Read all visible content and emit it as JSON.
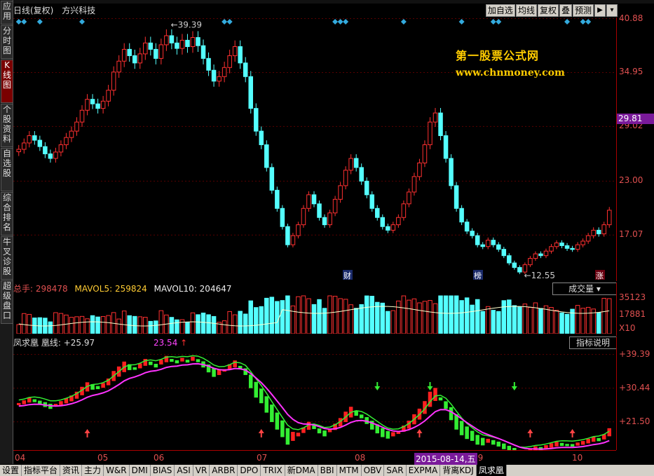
{
  "nav": [
    "应用",
    "分时图",
    "K线图",
    "个股资料",
    "自选股",
    "综合排名",
    "牛叉诊股",
    "超级盘口"
  ],
  "header": {
    "period": "日线(复权)",
    "stock": "方兴科技"
  },
  "toolbar": [
    "加自选",
    "均线",
    "复权",
    "叠",
    "预测"
  ],
  "watermark": {
    "line1": "第一股票公式网",
    "line2": "www.chnmoney.com"
  },
  "price_axis": {
    "ticks": [
      "40.88",
      "34.95",
      "29.02",
      "23.00",
      "17.07"
    ],
    "current": "29.81",
    "high_label": "39.39",
    "low_label": "12.55",
    "markers": [
      "财",
      "榜"
    ],
    "limit_tag": "涨"
  },
  "volume": {
    "total_label": "总手:",
    "total": "298478",
    "mavol5_label": "MAVOL5:",
    "mavol5": "259824",
    "mavol10_label": "MAVOL10:",
    "mavol10": "204647",
    "selector": "成交量",
    "ticks": [
      "35123",
      "17881",
      "X10"
    ]
  },
  "indicator": {
    "name": "凤求凰",
    "line_label": "凰线:",
    "value1": "+25.97",
    "value2": "+23.54",
    "value3": "23.54",
    "button": "指标说明",
    "ticks": [
      "+39.39",
      "+30.44",
      "+21.50"
    ]
  },
  "dates": {
    "labels": [
      "04",
      "05",
      "06",
      "07",
      "08",
      "09",
      "10"
    ],
    "selected": "2015-08-14,五"
  },
  "tabs": [
    "设置",
    "指标平台",
    "资讯",
    "主力",
    "W&R",
    "DMI",
    "BIAS",
    "ASI",
    "VR",
    "ARBR",
    "DPO",
    "TRIX",
    "新DMA",
    "BBI",
    "MTM",
    "OBV",
    "SAR",
    "EXPMA",
    "背离KDJ",
    "凤求凰"
  ],
  "active_tab": "凤求凰",
  "colors": {
    "up": "#ff3030",
    "down": "#54ffff",
    "axis": "#a00000",
    "selection": "#7a1a9a",
    "watermark": "#ffcc00"
  },
  "chart_data": {
    "type": "candlestick",
    "y_range": [
      12,
      41
    ],
    "closes": [
      26.5,
      27.2,
      28.0,
      27.5,
      26.8,
      26.0,
      25.5,
      26.2,
      27.0,
      27.8,
      28.5,
      29.5,
      30.8,
      32.0,
      31.5,
      31.0,
      31.8,
      33.0,
      35.0,
      36.2,
      37.5,
      36.8,
      36.0,
      37.0,
      38.2,
      37.5,
      36.5,
      38.0,
      39.0,
      38.2,
      37.6,
      38.5,
      37.8,
      38.8,
      37.9,
      36.5,
      35.2,
      34.0,
      34.5,
      35.5,
      36.8,
      37.8,
      36.0,
      34.5,
      31.0,
      28.5,
      27.0,
      24.5,
      22.0,
      20.0,
      18.0,
      16.0,
      17.0,
      18.2,
      20.0,
      21.5,
      20.5,
      19.0,
      18.2,
      19.5,
      21.0,
      22.5,
      24.2,
      25.5,
      24.5,
      23.0,
      21.5,
      20.0,
      19.0,
      18.0,
      17.6,
      18.2,
      19.0,
      20.5,
      21.8,
      23.5,
      25.0,
      27.0,
      29.5,
      30.5,
      28.0,
      25.5,
      22.5,
      20.0,
      18.5,
      17.5,
      17.0,
      16.0,
      15.8,
      16.5,
      16.0,
      15.5,
      14.8,
      14.0,
      13.5,
      13.0,
      13.8,
      14.5,
      15.0,
      14.8,
      15.3,
      15.8,
      16.2,
      15.9,
      15.6,
      15.5,
      16.0,
      16.4,
      17.0,
      17.6,
      17.2,
      18.2,
      19.8
    ]
  }
}
